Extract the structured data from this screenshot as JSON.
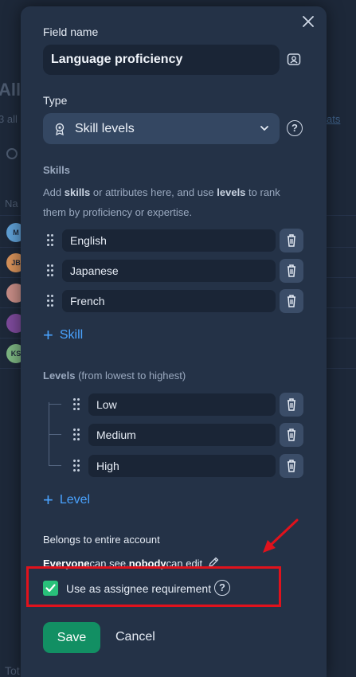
{
  "background": {
    "title": "All",
    "subtitle": "3 all",
    "link": "ats",
    "column": "Na",
    "footer": "Tot",
    "avatars": [
      {
        "initials": "M",
        "color": "#5fa0d6"
      },
      {
        "initials": "JB",
        "color": "#d7925a"
      },
      {
        "initials": "",
        "color": "#c78d86"
      },
      {
        "initials": "",
        "color": "#7d4a9b"
      },
      {
        "initials": "KS",
        "color": "#7db682"
      }
    ]
  },
  "modal": {
    "field_name_label": "Field name",
    "field_name_value": "Language proficiency",
    "type_label": "Type",
    "type_value": "Skill levels",
    "help_glyph": "?",
    "skills_label": "Skills",
    "skills_help_1": "Add ",
    "skills_help_bold_1": "skills",
    "skills_help_2": " or attributes here, and use ",
    "skills_help_bold_2": "levels",
    "skills_help_3": " to rank them by proficiency or expertise.",
    "skills": [
      "English",
      "Japanese",
      "French"
    ],
    "add_skill": "Skill",
    "levels_label": "Levels",
    "levels_hint": " (from lowest to highest)",
    "levels": [
      "Low",
      "Medium",
      "High"
    ],
    "add_level": "Level",
    "belongs_text": "Belongs to entire account",
    "perm_bold_1": "Everyone",
    "perm_text_1": " can see, ",
    "perm_bold_2": "nobody",
    "perm_text_2": " can edit",
    "checkbox_label": "Use as assignee requirement",
    "checkbox_checked": true,
    "save_label": "Save",
    "cancel_label": "Cancel",
    "colors": {
      "accent": "#4aa3ff",
      "save": "#128f63",
      "check": "#29c07a",
      "highlight": "#e0121c"
    }
  }
}
